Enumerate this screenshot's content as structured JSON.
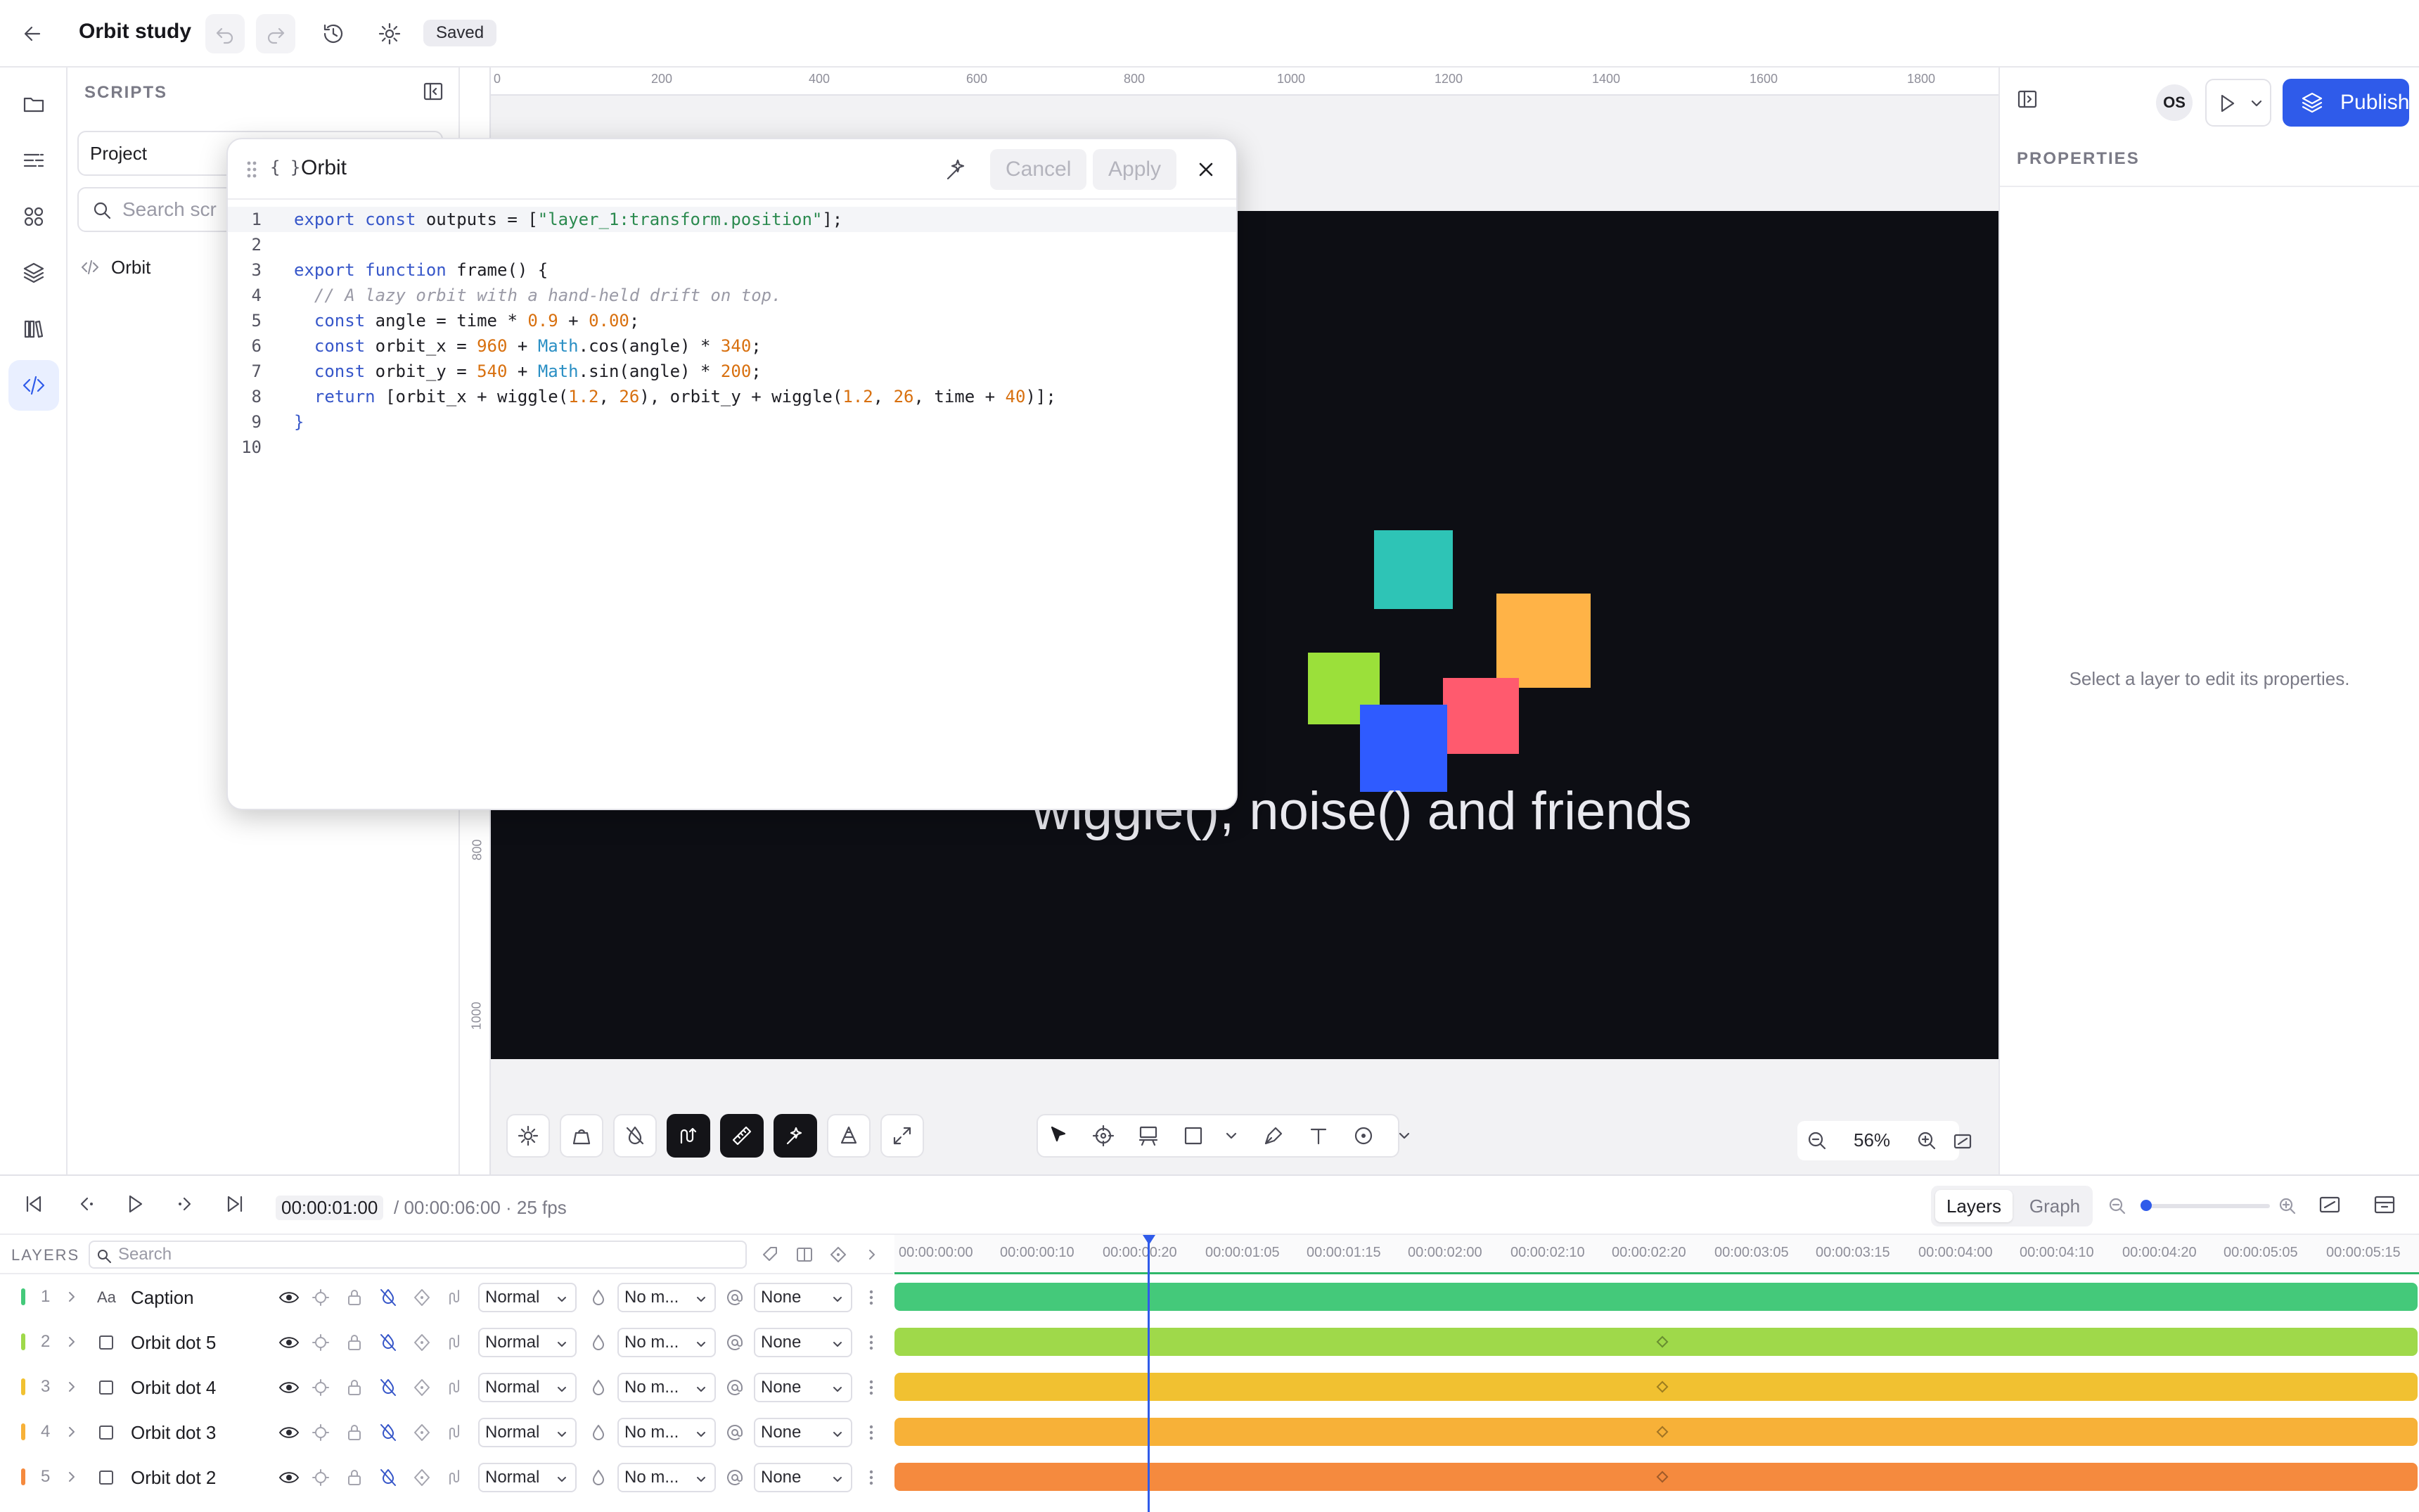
{
  "header": {
    "title": "Orbit study",
    "status": "Saved",
    "avatar": "OS",
    "publish_label": "Publish"
  },
  "scripts_panel": {
    "title": "SCRIPTS",
    "project_select": "Project",
    "search_placeholder": "Search scr",
    "items": [
      {
        "label": "Orbit"
      }
    ]
  },
  "editor": {
    "title": "Orbit",
    "cancel_label": "Cancel",
    "apply_label": "Apply"
  },
  "ruler_top": [
    "0",
    "200",
    "400",
    "600",
    "800",
    "1000",
    "1200",
    "1400",
    "1600",
    "1800"
  ],
  "ruler_left": [
    "800",
    "1000"
  ],
  "stage": {
    "caption": "wiggle(), noise() and friends",
    "colors": [
      "#2ec4b6",
      "#ffb347",
      "#9be03a",
      "#ff5a6e",
      "#2f5bff"
    ]
  },
  "zoom": {
    "value": "56%"
  },
  "properties": {
    "title": "PROPERTIES",
    "empty_message": "Select a layer to edit its properties."
  },
  "timeline": {
    "current_time": "00:00:01:00",
    "total": "/ 00:00:06:00 · 25 fps",
    "tabs": [
      "Layers",
      "Graph"
    ],
    "layers_label": "LAYERS",
    "search_placeholder": "Search",
    "ticks": [
      "00:00:00:00",
      "00:00:00:10",
      "00:00:00:20",
      "00:00:01:05",
      "00:00:01:15",
      "00:00:02:00",
      "00:00:02:10",
      "00:00:02:20",
      "00:00:03:05",
      "00:00:03:15",
      "00:00:04:00",
      "00:00:04:10",
      "00:00:04:20",
      "00:00:05:05",
      "00:00:05:15"
    ],
    "rows": [
      {
        "num": "1",
        "name": "Caption",
        "type": "text",
        "blend": "Normal",
        "mask": "No m...",
        "parent": "None",
        "color": "#44c97a"
      },
      {
        "num": "2",
        "name": "Orbit dot 5",
        "type": "shape",
        "blend": "Normal",
        "mask": "No m...",
        "parent": "None",
        "color": "#9fd94a"
      },
      {
        "num": "3",
        "name": "Orbit dot 4",
        "type": "shape",
        "blend": "Normal",
        "mask": "No m...",
        "parent": "None",
        "color": "#f1c131"
      },
      {
        "num": "4",
        "name": "Orbit dot 3",
        "type": "shape",
        "blend": "Normal",
        "mask": "No m...",
        "parent": "None",
        "color": "#f7b138"
      },
      {
        "num": "5",
        "name": "Orbit dot 2",
        "type": "shape",
        "blend": "Normal",
        "mask": "No m...",
        "parent": "None",
        "color": "#f58a3e"
      }
    ]
  },
  "colors": {
    "accent": "#2f5bea",
    "stage_bg": "#0d0e14"
  }
}
